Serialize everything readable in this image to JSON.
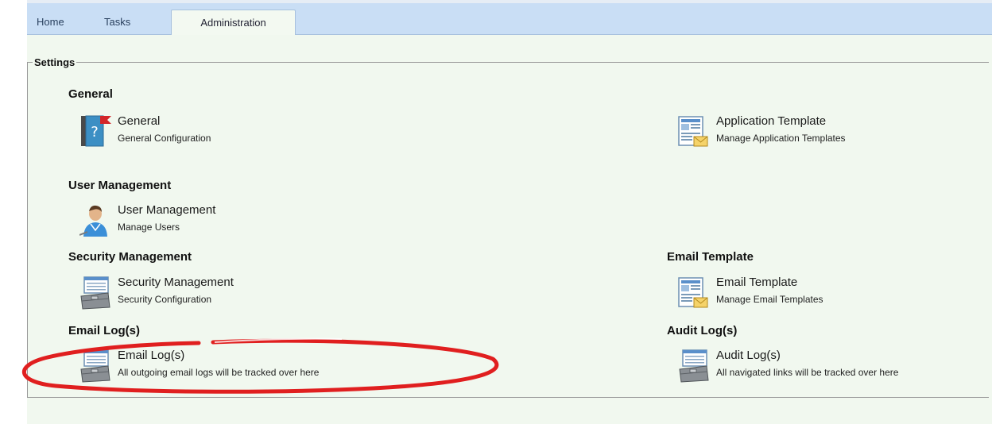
{
  "tabs": [
    {
      "label": "Home"
    },
    {
      "label": "Tasks"
    },
    {
      "label": "Administration"
    }
  ],
  "settings": {
    "legend": "Settings",
    "sections": {
      "general": {
        "heading": "General",
        "item": {
          "title": "General",
          "description": "General Configuration",
          "icon": "help-book-icon"
        }
      },
      "application_template": {
        "item": {
          "title": "Application Template",
          "description": "Manage Application Templates",
          "icon": "email-template-icon"
        }
      },
      "user_management": {
        "heading": "User Management",
        "item": {
          "title": "User Management",
          "description": "Manage Users",
          "icon": "user-icon"
        }
      },
      "security_management": {
        "heading": "Security Management",
        "item": {
          "title": "Security Management",
          "description": "Security Configuration",
          "icon": "toolbox-icon"
        }
      },
      "email_template": {
        "heading": "Email Template",
        "item": {
          "title": "Email Template",
          "description": "Manage Email Templates",
          "icon": "email-template-icon"
        }
      },
      "email_logs": {
        "heading": "Email Log(s)",
        "item": {
          "title": "Email Log(s)",
          "description": "All outgoing email logs will be tracked over here",
          "icon": "toolbox-icon"
        }
      },
      "audit_logs": {
        "heading": "Audit Log(s)",
        "item": {
          "title": "Audit Log(s)",
          "description": "All navigated links will be tracked over here",
          "icon": "toolbox-icon"
        }
      }
    }
  },
  "colors": {
    "tabbar": "#c9def5",
    "content_bg": "#f1f8ef",
    "highlight": "#e01f1f"
  }
}
